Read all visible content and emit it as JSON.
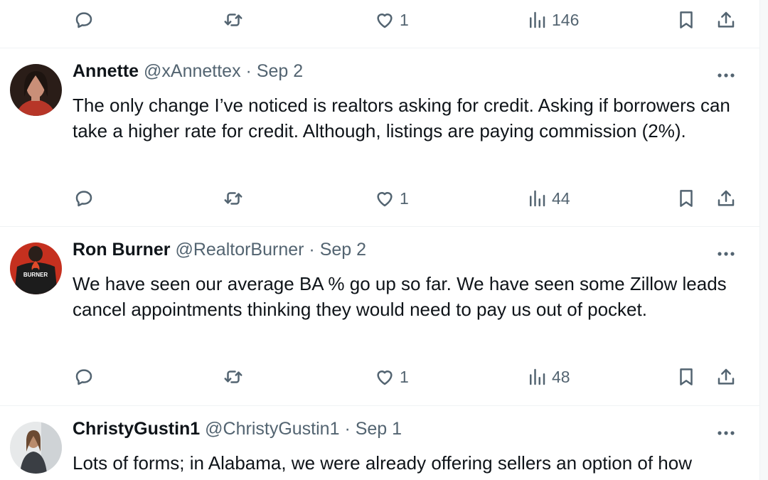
{
  "top_actions": {
    "reply": "",
    "retweet": "",
    "like": "1",
    "views": "146"
  },
  "tweets": [
    {
      "name": "Annette",
      "handle": "@xAnnettex",
      "dot": "·",
      "time": "Sep 2",
      "text": "The only change I’ve noticed is realtors asking for credit. Asking if borrowers can take a higher rate for credit. Although, listings are paying commission (2%).",
      "actions": {
        "reply": "",
        "retweet": "",
        "like": "1",
        "views": "44"
      }
    },
    {
      "name": "Ron Burner",
      "handle": "@RealtorBurner",
      "dot": "·",
      "time": "Sep 2",
      "avatar_text": "BURNER",
      "text": "We have seen our average BA % go up so far. We have seen some Zillow leads cancel appointments thinking they would need to pay us out of pocket.",
      "actions": {
        "reply": "",
        "retweet": "",
        "like": "1",
        "views": "48"
      }
    },
    {
      "name": "ChristyGustin1",
      "handle": "@ChristyGustin1",
      "dot": "·",
      "time": "Sep 1",
      "text": "Lots of forms; in Alabama, we were already offering sellers an option of how"
    }
  ],
  "colors": {
    "text_primary": "#0f1419",
    "text_secondary": "#536471",
    "divider": "#eff3f4"
  }
}
